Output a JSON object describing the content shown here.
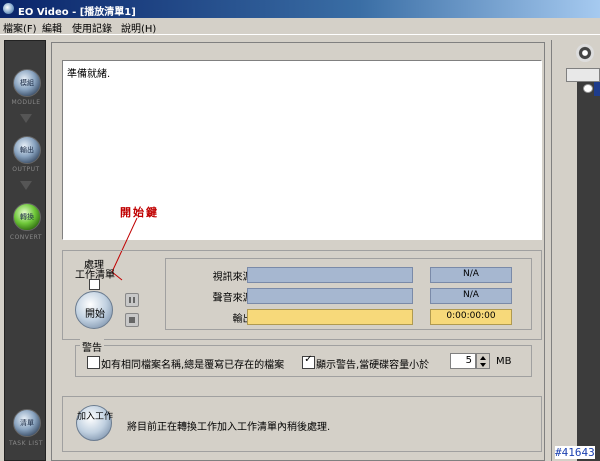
{
  "window": {
    "title": "EO Video - [播放清單1]"
  },
  "menu": {
    "file": "檔案(F)",
    "edit": "編輯",
    "history": "使用記錄",
    "help": "說明(H)"
  },
  "rail": {
    "module_glyph": "模組",
    "module_label": "MODULE",
    "output_glyph": "輸出",
    "output_label": "OUTPUT",
    "convert_glyph": "轉換",
    "convert_label": "CONVERT",
    "tasklist_glyph": "清單",
    "tasklist_label": "TASK LIST"
  },
  "log": {
    "text": "準備就緒."
  },
  "annotation": {
    "text": "開始鍵"
  },
  "process": {
    "label": "處理",
    "queue_label": "工作清單",
    "start_label": "開始"
  },
  "info": {
    "video_label": "視訊來源:",
    "video_value": "N/A",
    "audio_label": "聲音來源:",
    "audio_value": "N/A",
    "output_label": "輸出:",
    "output_value": "0:00:00:00"
  },
  "warning": {
    "label": "警告",
    "overwrite_label": "如有相同檔案名稱,總是覆寫已存在的檔案",
    "overwrite_checked": false,
    "disk_label": "顯示警告,當硬碟容量小於",
    "disk_checked": true,
    "disk_value": "5",
    "disk_unit": "MB"
  },
  "add": {
    "button_label": "加入工作",
    "text": "將目前正在轉換工作加入工作清單內稍後處理."
  },
  "watermark": "#41643",
  "colors": {
    "title_start": "#0a246a",
    "annotation": "#c00000",
    "bar_blue": "#a6b7d0",
    "bar_yellow": "#f7d97a"
  }
}
